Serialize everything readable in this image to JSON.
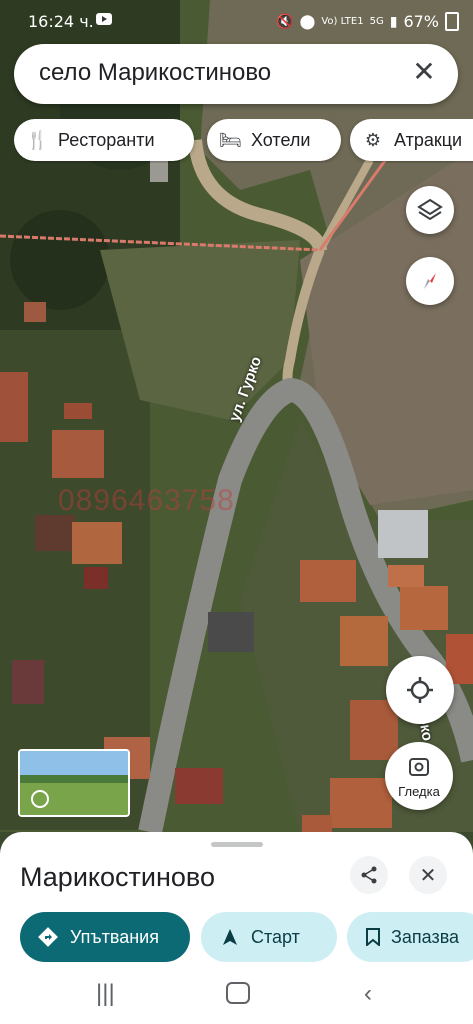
{
  "status": {
    "time": "16:24 ч.",
    "battery": "67%",
    "network": "Vo) LTE1",
    "signal": "5G"
  },
  "search": {
    "query": "село Марикостиново"
  },
  "chips": [
    {
      "label": "Ресторанти",
      "icon": "fork-knife-icon"
    },
    {
      "label": "Хотели",
      "icon": "bed-icon"
    },
    {
      "label": "Атракци",
      "icon": "attraction-icon"
    }
  ],
  "map": {
    "street_label_1": "ул. Гурко",
    "street_label_2": "урко",
    "watermark": "0896463758"
  },
  "controls": {
    "street_view_label": "Гледка"
  },
  "place": {
    "name": "Марикостиново"
  },
  "actions": [
    {
      "label": "Упътвания",
      "icon": "directions-icon"
    },
    {
      "label": "Старт",
      "icon": "navigation-arrow-icon"
    },
    {
      "label": "Запазва",
      "icon": "bookmark-icon"
    }
  ],
  "colors": {
    "primary": "#0b6a74",
    "chip_light": "#cdeef3",
    "text": "#202124"
  }
}
